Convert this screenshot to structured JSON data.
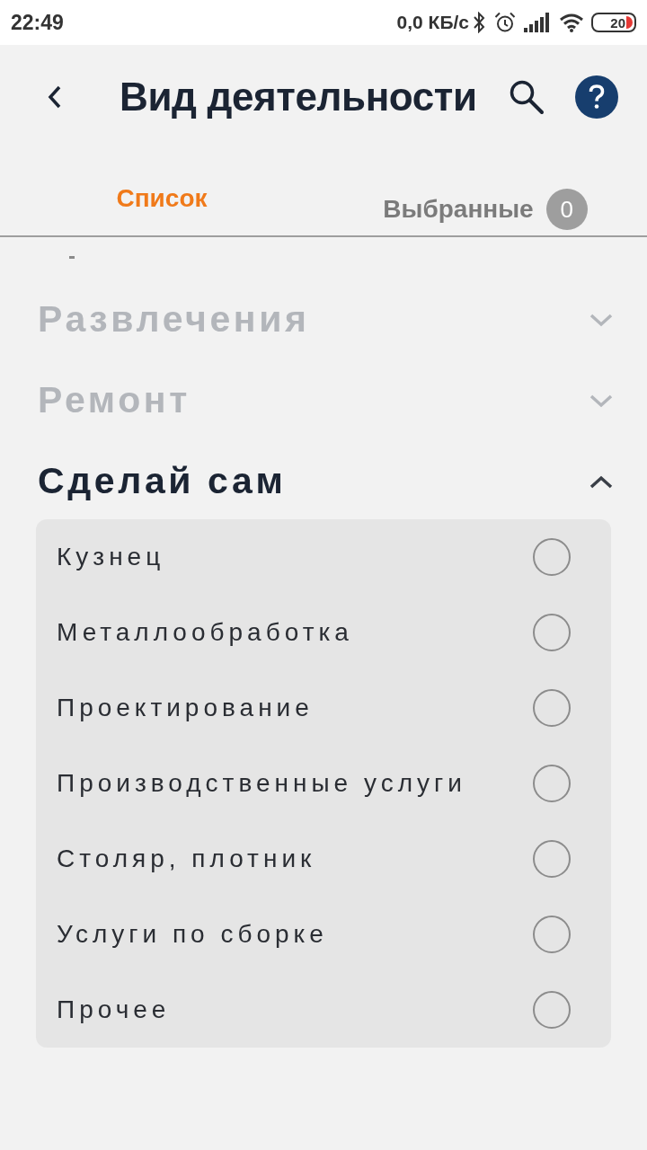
{
  "status_bar": {
    "time": "22:49",
    "network_speed": "0,0 КБ/с",
    "battery": "20"
  },
  "header": {
    "title": "Вид деятельности"
  },
  "tabs": [
    {
      "label": "Список",
      "selected": true
    },
    {
      "label": "Выбранные",
      "selected": false,
      "count": "0"
    }
  ],
  "categories": [
    {
      "label": "Развлечения",
      "expanded": false
    },
    {
      "label": "Ремонт",
      "expanded": false
    },
    {
      "label": "Сделай сам",
      "expanded": true,
      "items": [
        {
          "label": "Кузнец",
          "selected": false
        },
        {
          "label": "Металлообработка",
          "selected": false
        },
        {
          "label": "Проектирование",
          "selected": false
        },
        {
          "label": "Производственные услуги",
          "selected": false
        },
        {
          "label": "Столяр, плотник",
          "selected": false
        },
        {
          "label": "Услуги по сборке",
          "selected": false
        },
        {
          "label": "Прочее",
          "selected": false
        }
      ]
    }
  ]
}
